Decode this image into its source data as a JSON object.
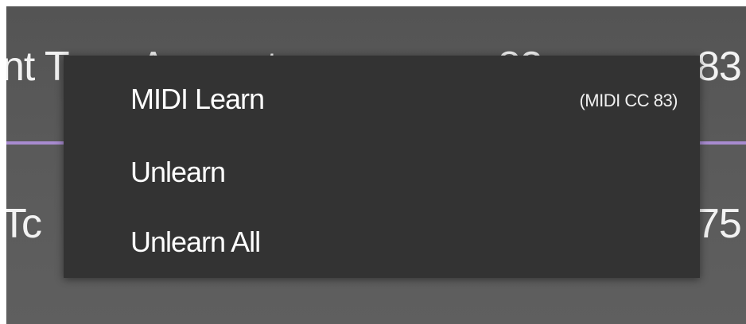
{
  "params": [
    {
      "name": "nt Tone Amount",
      "cc": "83",
      "value": "83"
    },
    {
      "name": "Tc",
      "cc": "",
      "value": "75"
    }
  ],
  "context_menu": {
    "items": [
      {
        "label": "MIDI Learn",
        "shortcut": "(MIDI CC 83)"
      },
      {
        "label": "Unlearn"
      },
      {
        "label": "Unlearn All"
      }
    ]
  },
  "colors": {
    "background": "#5a5a5a",
    "menu_background": "#333333",
    "slider_accent": "#a88bd0",
    "text": "#ffffff"
  }
}
